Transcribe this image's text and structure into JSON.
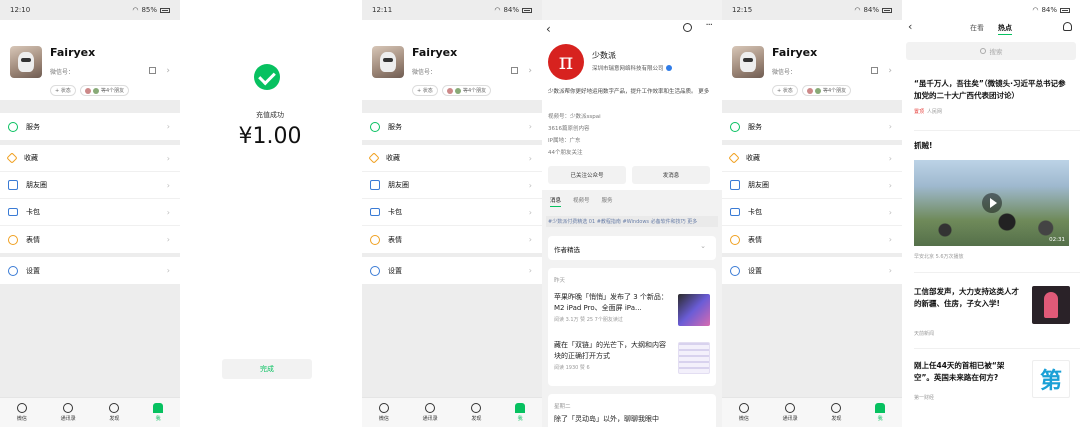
{
  "panels": {
    "me1": {
      "status": {
        "time": "12:10",
        "battery": "85%"
      },
      "name": "Fairyex",
      "wxid_label": "微信号：",
      "status_btn": "+ 状态",
      "friends_text": "等4个朋友",
      "menu": [
        "服务",
        "收藏",
        "朋友圈",
        "卡包",
        "表情",
        "设置"
      ]
    },
    "pay": {
      "label": "充值成功",
      "amount": "¥1.00",
      "done": "完成"
    },
    "me2": {
      "status": {
        "time": "12:11",
        "battery": "84%"
      }
    },
    "oa": {
      "name": "少数派",
      "company": "深圳市瑞意网络科技有限公司",
      "desc": "少数派帮你更好地运用数字产品，提升工作效率和生活品质。 更多",
      "wechat_id": "视频号：少数派sspai",
      "articles_count": "3616篇原创内容",
      "ip": "IP属地：广东",
      "friends_follow": "44个朋友关注",
      "follow_btn": "已关注公众号",
      "message_btn": "发消息",
      "tabs": [
        "消息",
        "视频号",
        "服务"
      ],
      "tags": "#少数派付费精选 01    #教程指南    #Windows 必备软件和技巧 更多",
      "picks": "作者精选",
      "section1": "昨天",
      "articles": [
        {
          "title": "苹果昨晚「悄悄」发布了 3 个新品：M2 iPad Pro、全面屏 iPa...",
          "meta": "阅读 3.1万  赞 25  7个朋友读过"
        },
        {
          "title": "藏在「双链」的光芒下，大纲和内容块的正确打开方式",
          "meta": "阅读 1930  赞 6"
        }
      ],
      "section2": "星期二",
      "article3": "除了「灵动岛」以外，聊聊我眼中"
    },
    "me3": {
      "status": {
        "time": "12:15",
        "battery": "84%"
      }
    },
    "ts": {
      "status": {
        "battery": "84%"
      },
      "tabs": [
        "在看",
        "热点"
      ],
      "search": "搜索",
      "items": [
        {
          "title": "“虽千万人，吾往矣”（微镜头·习近平总书记参加党的二十大广西代表团讨论）",
          "badge": "置顶",
          "source": "人民网"
        },
        {
          "title": "抓贼!",
          "source": "早安北京  5.6万次播放",
          "duration": "02:31"
        },
        {
          "title": "工信部发声，大力支持这类人才的新疆、住房，子女入学!",
          "source": "天前新闻"
        },
        {
          "title": "刚上任44天的首相已被“架空”。英国未来路在何方?",
          "source": "第一财经",
          "thumb_text": "第"
        }
      ]
    }
  },
  "tabbar": [
    "微信",
    "通讯录",
    "发现",
    "我"
  ],
  "colors": {
    "wechat_green": "#07c160",
    "oa_red": "#d7221f",
    "link_blue": "#6a7fa8"
  }
}
